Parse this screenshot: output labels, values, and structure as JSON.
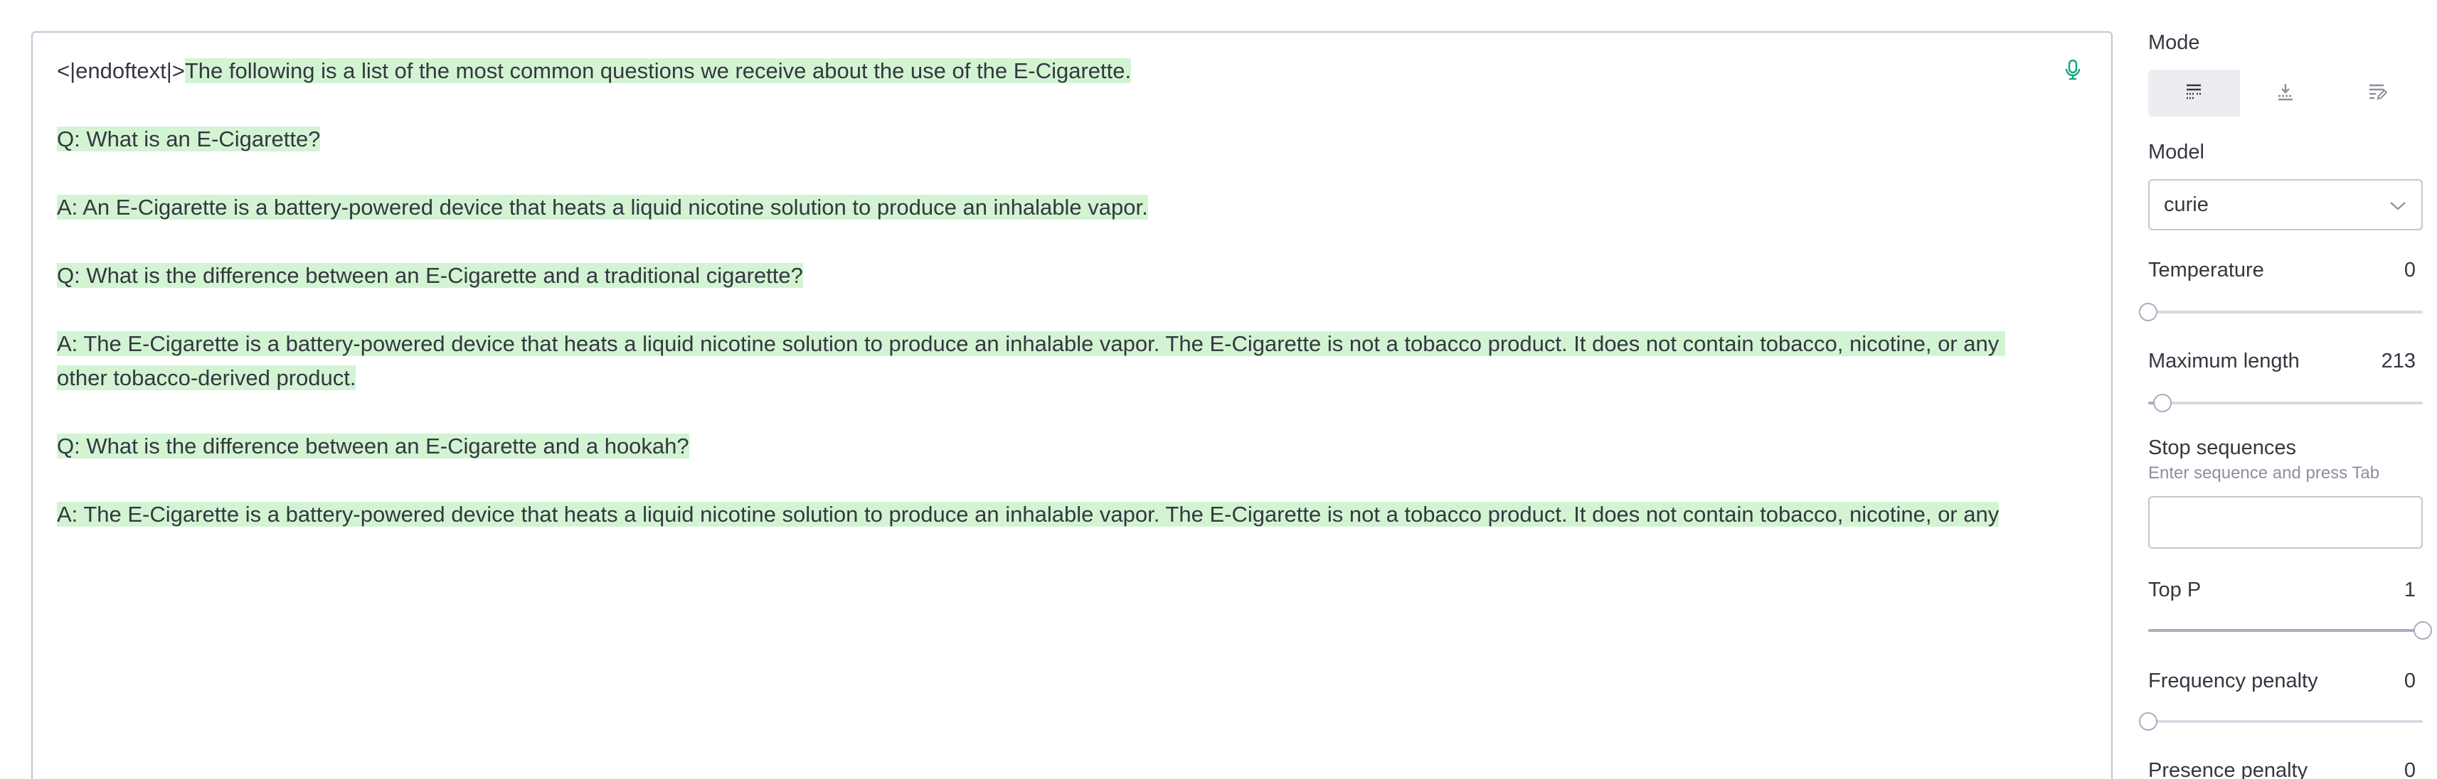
{
  "editor": {
    "paragraphs": [
      {
        "prompt": "<|endoftext|>",
        "generated": "The following is a list of the most common questions we receive about the use of the E-Cigarette."
      },
      {
        "prompt": "",
        "generated": "Q: What is an E-Cigarette?"
      },
      {
        "prompt": "",
        "generated": "A: An E-Cigarette is a battery-powered device that heats a liquid nicotine solution to produce an inhalable vapor."
      },
      {
        "prompt": "",
        "generated": "Q: What is the difference between an E-Cigarette and a traditional cigarette?"
      },
      {
        "prompt": "",
        "generated": "A: The E-Cigarette is a battery-powered device that heats a liquid nicotine solution to produce an inhalable vapor. The E-Cigarette is not a tobacco product. It does not contain tobacco, nicotine, or any other tobacco-derived product."
      },
      {
        "prompt": "",
        "generated": "Q: What is the difference between an E-Cigarette and a hookah?"
      },
      {
        "prompt": "",
        "generated": "A: The E-Cigarette is a battery-powered device that heats a liquid nicotine solution to produce an inhalable vapor. The E-Cigarette is not a tobacco product. It does not contain tobacco, nicotine, or any"
      }
    ],
    "mic_icon": "microphone-icon"
  },
  "sidebar": {
    "mode": {
      "label": "Mode",
      "options": [
        {
          "icon": "complete-mode-icon",
          "active": true
        },
        {
          "icon": "insert-mode-icon",
          "active": false
        },
        {
          "icon": "edit-mode-icon",
          "active": false
        }
      ]
    },
    "model": {
      "label": "Model",
      "value": "curie"
    },
    "temperature": {
      "label": "Temperature",
      "value": "0",
      "fraction": 0
    },
    "max_length": {
      "label": "Maximum length",
      "value": "213",
      "fraction": 0.052
    },
    "stop_sequences": {
      "label": "Stop sequences",
      "hint": "Enter sequence and press Tab",
      "value": ""
    },
    "top_p": {
      "label": "Top P",
      "value": "1",
      "fraction": 1
    },
    "frequency_penalty": {
      "label": "Frequency penalty",
      "value": "0",
      "fraction": 0
    },
    "presence_penalty": {
      "label": "Presence penalty",
      "value": "0"
    }
  },
  "colors": {
    "highlight": "#d2f4d3",
    "accent": "#10a37f",
    "border": "#c5c5d2"
  }
}
